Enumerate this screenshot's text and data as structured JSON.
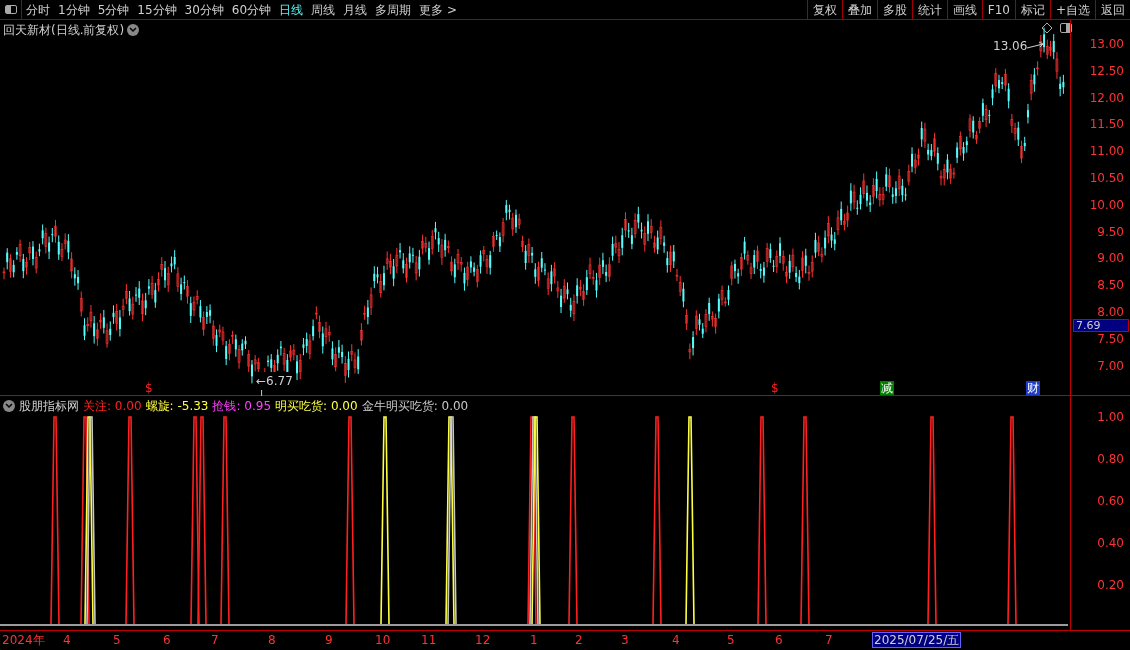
{
  "toolbar": {
    "periods": [
      {
        "label": "分时",
        "selected": false
      },
      {
        "label": "1分钟",
        "selected": false
      },
      {
        "label": "5分钟",
        "selected": false
      },
      {
        "label": "15分钟",
        "selected": false
      },
      {
        "label": "30分钟",
        "selected": false
      },
      {
        "label": "60分钟",
        "selected": false
      },
      {
        "label": "日线",
        "selected": true
      },
      {
        "label": "周线",
        "selected": false
      },
      {
        "label": "月线",
        "selected": false
      },
      {
        "label": "多周期",
        "selected": false
      }
    ],
    "more": "更多 >",
    "buttons": [
      "复权",
      "叠加",
      "多股",
      "统计",
      "画线",
      "F10",
      "标记",
      "+自选",
      "返回"
    ]
  },
  "main_chart": {
    "title": "回天新材(日线.前复权)",
    "high_label": "13.06",
    "low_label": "←6.77",
    "price_axis": [
      "13.00",
      "12.50",
      "12.00",
      "11.50",
      "11.00",
      "10.50",
      "10.00",
      "9.50",
      "9.00",
      "8.50",
      "8.00",
      "7.50",
      "7.00"
    ],
    "current_price": "7.69",
    "markers": [
      {
        "text": "$",
        "kind": "dividend"
      },
      {
        "text": "$",
        "kind": "dividend"
      },
      {
        "text": "减",
        "kind": "reduce"
      },
      {
        "text": "财",
        "kind": "finance"
      }
    ]
  },
  "indicator": {
    "name": "股朋指标网",
    "legend": [
      {
        "label": "关注: 0.00",
        "color": "#ff2020"
      },
      {
        "label": "螺旋: -5.33",
        "color": "#ffff40"
      },
      {
        "label": "抢钱: 0.95",
        "color": "#ff40ff"
      },
      {
        "label": "明买吃货: 0.00",
        "color": "#ffff40"
      },
      {
        "label": "金牛明买吃货: 0.00",
        "color": "#c8c8c8"
      }
    ],
    "axis": [
      "1.00",
      "0.80",
      "0.60",
      "0.40",
      "0.20"
    ]
  },
  "date_axis": [
    "2024年",
    "4",
    "5",
    "6",
    "7",
    "8",
    "9",
    "10",
    "11",
    "12",
    "1",
    "2",
    "3",
    "4",
    "5",
    "6",
    "7"
  ],
  "cursor_date": "2025/07/25/五"
}
